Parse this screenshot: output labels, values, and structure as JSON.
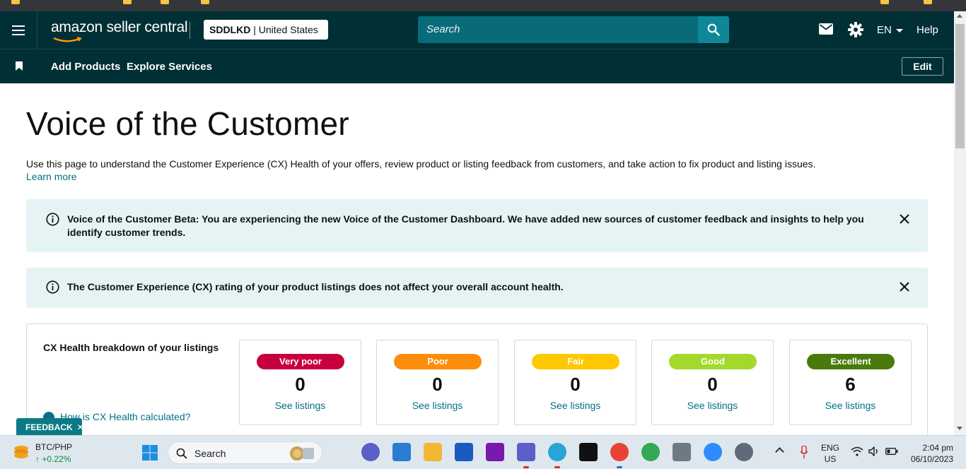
{
  "header": {
    "logo_text": "amazon seller central",
    "account_name": "SDDLKD",
    "account_region": "| United States",
    "search_placeholder": "Search",
    "language": "EN",
    "help": "Help",
    "icons": [
      "hamburger-menu-icon",
      "search-icon",
      "mail-icon",
      "gear-icon"
    ]
  },
  "subnav": {
    "links": [
      "Add Products",
      "Explore Services"
    ],
    "edit": "Edit"
  },
  "page": {
    "title": "Voice of the Customer",
    "description": "Use this page to understand the Customer Experience (CX) Health of your offers, review product or listing feedback from customers, and take action to fix product and listing issues.",
    "learn_more": "Learn more"
  },
  "alerts": [
    {
      "text": "Voice of the Customer Beta: You are experiencing the new Voice of the Customer Dashboard. We have added new sources of customer feedback and insights to help you identify customer trends."
    },
    {
      "text": "The Customer Experience (CX) rating of your product listings does not affect your overall account health."
    }
  ],
  "cx_health": {
    "heading": "CX Health breakdown of your listings",
    "how_link": "How is CX Health calculated?",
    "tiles": [
      {
        "label": "Very poor",
        "count": "0",
        "link": "See listings",
        "color": "#c7003e",
        "text_color": "#ffffff"
      },
      {
        "label": "Poor",
        "count": "0",
        "link": "See listings",
        "color": "#ff8c0a",
        "text_color": "#ffffff"
      },
      {
        "label": "Fair",
        "count": "0",
        "link": "See listings",
        "color": "#ffc800",
        "text_color": "#ffffff"
      },
      {
        "label": "Good",
        "count": "0",
        "link": "See listings",
        "color": "#a3d92b",
        "text_color": "#ffffff"
      },
      {
        "label": "Excellent",
        "count": "6",
        "link": "See listings",
        "color": "#4a7a0b",
        "text_color": "#ffffff"
      }
    ]
  },
  "feedback_tab": "FEEDBACK",
  "taskbar": {
    "ticker_name": "BTC/PHP",
    "ticker_change": "+0.22%",
    "search_label": "Search",
    "language_line1": "ENG",
    "language_line2": "US",
    "time": "2:04 pm",
    "date": "06/10/2023"
  },
  "colors": {
    "header_bg": "#002f36",
    "link": "#007185",
    "alert_bg": "#e6f3f5"
  }
}
